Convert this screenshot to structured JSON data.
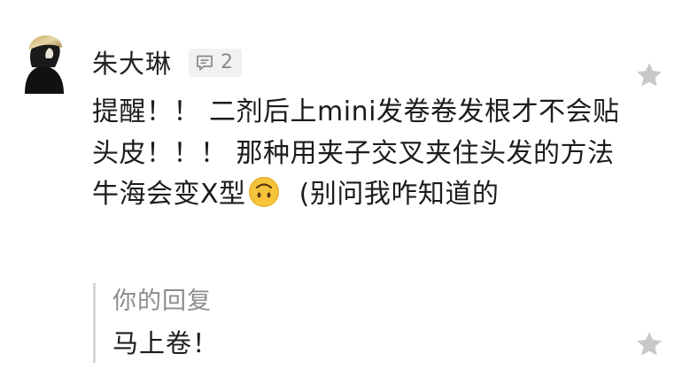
{
  "comment": {
    "author": "朱大琳",
    "reply_count": "2",
    "text_before_emoji": "提醒！！ 二剂后上mini发卷卷发根才不会贴头皮！！！ 那种用夹子交叉夹住头发的方法牛海会变X型",
    "emoji_icon": "upside-down-face-icon",
    "text_after_emoji": "  (别问我咋知道的"
  },
  "reply": {
    "label": "你的回复",
    "text": "马上卷！"
  },
  "colors": {
    "star": "#c8c8c8",
    "badge_bg": "#f1f1f1",
    "quote_bar": "#d6d6d6",
    "muted_text": "#8c8c8c",
    "emoji_face": "#f7c33a"
  }
}
